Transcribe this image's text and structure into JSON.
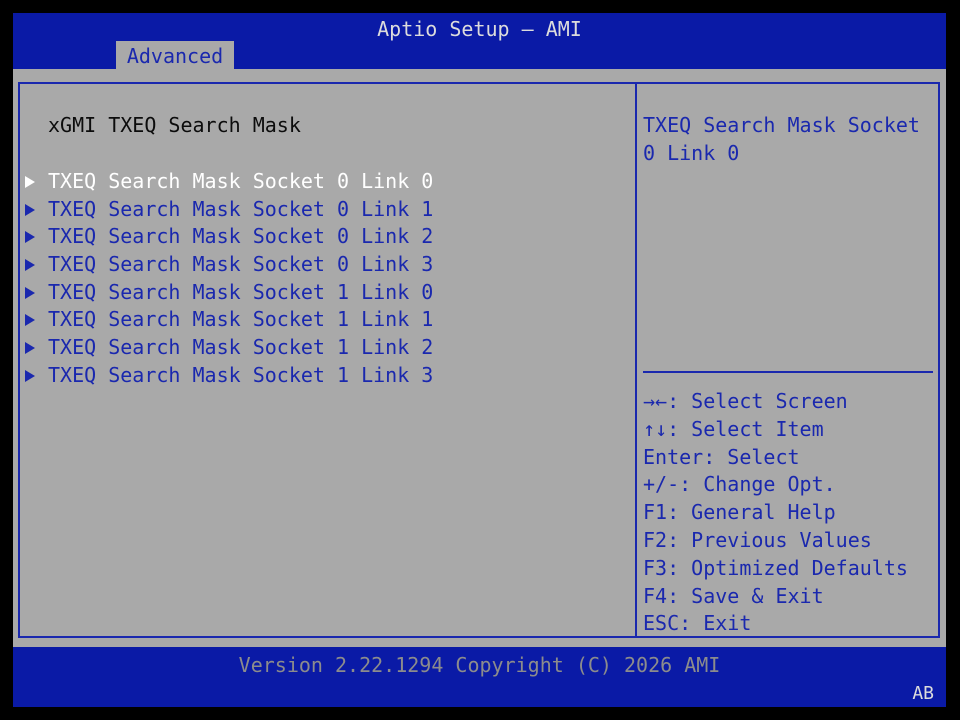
{
  "header": {
    "title": "Aptio Setup – AMI",
    "tabs": [
      {
        "label": "Advanced"
      }
    ]
  },
  "left": {
    "title": "xGMI TXEQ Search Mask",
    "items": [
      {
        "label": "TXEQ Search Mask Socket 0 Link 0",
        "selected": true
      },
      {
        "label": "TXEQ Search Mask Socket 0 Link 1"
      },
      {
        "label": "TXEQ Search Mask Socket 0 Link 2"
      },
      {
        "label": "TXEQ Search Mask Socket 0 Link 3"
      },
      {
        "label": "TXEQ Search Mask Socket 1 Link 0"
      },
      {
        "label": "TXEQ Search Mask Socket 1 Link 1"
      },
      {
        "label": "TXEQ Search Mask Socket 1 Link 2"
      },
      {
        "label": "TXEQ Search Mask Socket 1 Link 3"
      }
    ]
  },
  "help": {
    "text": "TXEQ Search Mask Socket\n0 Link 0"
  },
  "keys": [
    "→←: Select Screen",
    "↑↓: Select Item",
    "Enter: Select",
    "+/-: Change Opt.",
    "F1: General Help",
    "F2: Previous Values",
    "F3: Optimized Defaults",
    "F4: Save & Exit",
    "ESC: Exit"
  ],
  "footer": {
    "version": "Version 2.22.1294 Copyright (C) 2026 AMI",
    "badge": "AB"
  },
  "colors": {
    "header_bg": "#0a1aa6",
    "panel_bg": "#a9a9a9",
    "accent": "#1a28ae",
    "selected_text": "#ffffff"
  }
}
